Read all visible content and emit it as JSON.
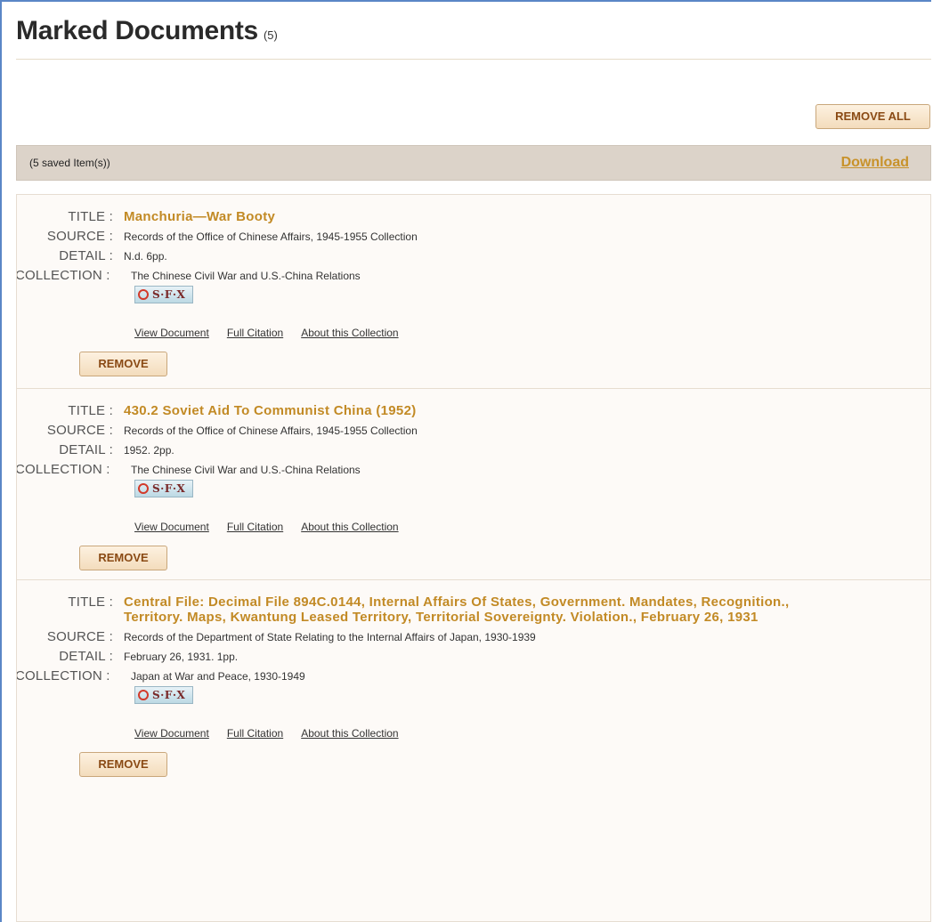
{
  "header": {
    "title": "Marked Documents",
    "count": "(5)"
  },
  "toolbar": {
    "remove_all_label": "REMOVE ALL"
  },
  "summary_bar": {
    "saved_text": "(5  saved Item(s))",
    "download_label": "Download"
  },
  "labels": {
    "title": "TITLE :",
    "source": "SOURCE :",
    "detail": "DETAIL :",
    "collection": "COLLECTION :"
  },
  "items": [
    {
      "title": "Manchuria—War Booty",
      "source": "Records of the Office of Chinese Affairs, 1945-1955 Collection",
      "detail": "N.d. 6pp.",
      "collection": "The Chinese Civil War and U.S.-China Relations",
      "sfx_label": "S·F·X",
      "links": {
        "view": "View Document",
        "citation": "Full Citation",
        "about": "About this Collection"
      },
      "remove_label": "REMOVE"
    },
    {
      "title": "430.2 Soviet Aid To Communist China (1952)",
      "source": "Records of the Office of Chinese Affairs, 1945-1955 Collection",
      "detail": "1952. 2pp.",
      "collection": "The Chinese Civil War and U.S.-China Relations",
      "sfx_label": "S·F·X",
      "links": {
        "view": "View Document",
        "citation": "Full Citation",
        "about": "About this Collection"
      },
      "remove_label": "REMOVE"
    },
    {
      "title": "Central File: Decimal File 894C.0144, Internal Affairs Of States, Government. Mandates, Recognition., Territory. Maps, Kwantung Leased Territory, Territorial Sovereignty. Violation., February 26, 1931",
      "source": "Records of the Department of State Relating to the Internal Affairs of Japan, 1930-1939",
      "detail": "February 26, 1931. 1pp.",
      "collection": "Japan at War and Peace, 1930-1949",
      "sfx_label": "S·F·X",
      "links": {
        "view": "View Document",
        "citation": "Full Citation",
        "about": "About this Collection"
      },
      "remove_label": "REMOVE"
    }
  ],
  "colors": {
    "accent": "#c28a25",
    "bar_bg": "#dcd3c9",
    "frame_border": "#5a86c6",
    "button_text": "#8a4a14"
  }
}
